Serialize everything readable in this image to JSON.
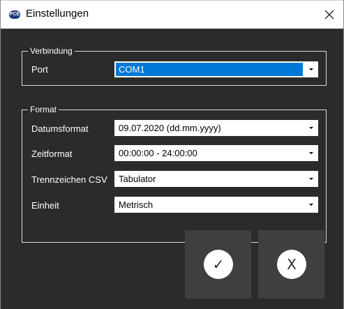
{
  "window": {
    "title": "Einstellungen",
    "app_icon_text": "PCE"
  },
  "verbindung": {
    "legend": "Verbindung",
    "port_label": "Port",
    "port_value": "COM1"
  },
  "format": {
    "legend": "Format",
    "rows": [
      {
        "label": "Datumsformat",
        "value": "09.07.2020 (dd.mm.yyyy)"
      },
      {
        "label": "Zeitformat",
        "value": "00:00:00 - 24:00:00"
      },
      {
        "label": "Trennzeichen CSV",
        "value": "Tabulator"
      },
      {
        "label": "Einheit",
        "value": "Metrisch"
      }
    ]
  },
  "buttons": {
    "ok_glyph": "✓",
    "cancel_glyph": "X"
  },
  "colors": {
    "background": "#2b2b2b",
    "selection": "#0078d7",
    "button": "#3f3f3f"
  }
}
